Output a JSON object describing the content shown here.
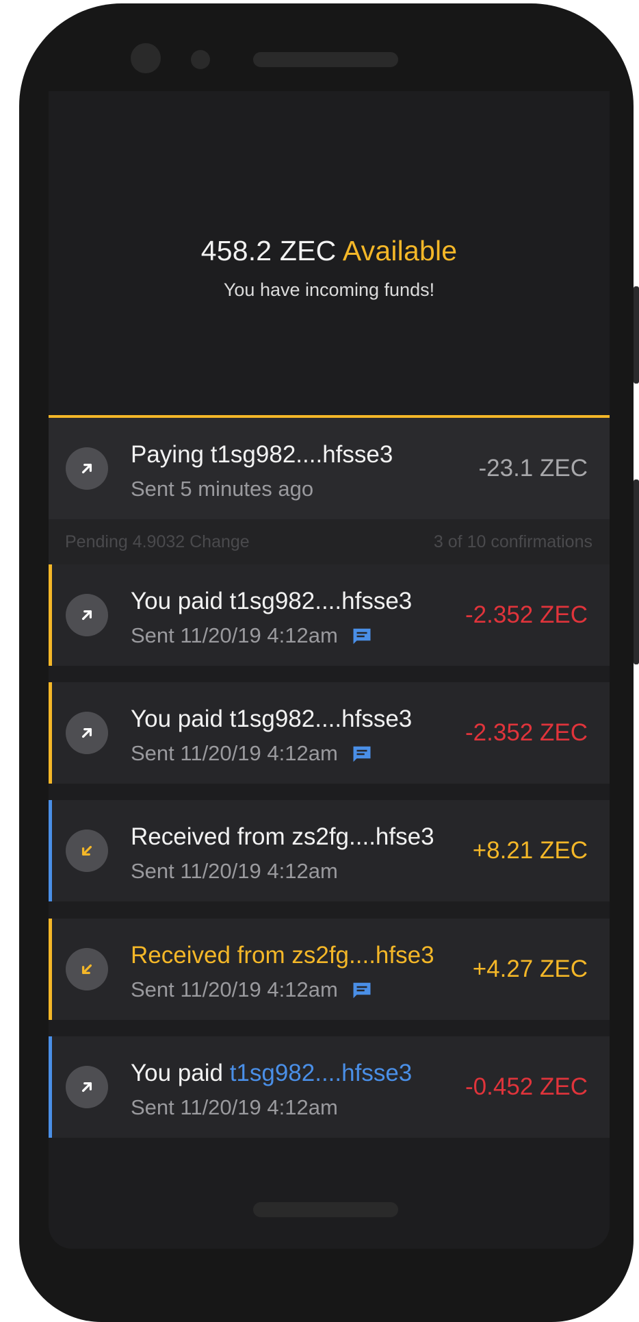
{
  "balance": {
    "amount": "458.2 ZEC",
    "status": "Available",
    "message": "You have incoming funds!"
  },
  "pending": {
    "title": "Paying t1sg982....hfsse3",
    "subtitle": "Sent 5 minutes ago",
    "amount": "-23.1 ZEC",
    "icon": "arrow-up-right-icon",
    "change": "Pending 4.9032 Change",
    "confirmations": "3 of 10 confirmations"
  },
  "transactions": [
    {
      "title": "You paid t1sg982....hfsse3",
      "subtitle": "Sent 11/20/19 4:12am",
      "amount": "-2.352 ZEC",
      "direction": "sent",
      "has_memo": true,
      "accent": "#f4b728",
      "amount_color": "#e0343b"
    },
    {
      "title": "You paid t1sg982....hfsse3",
      "subtitle": "Sent 11/20/19 4:12am",
      "amount": "-2.352 ZEC",
      "direction": "sent",
      "has_memo": true,
      "accent": "#f4b728",
      "amount_color": "#e0343b"
    },
    {
      "title": "Received from zs2fg....hfse3",
      "subtitle": "Sent 11/20/19 4:12am",
      "amount": "+8.21 ZEC",
      "direction": "received",
      "has_memo": false,
      "accent": "#4a8fe7",
      "amount_color": "#f4b728"
    },
    {
      "title": "Received from zs2fg....hfse3",
      "subtitle": "Sent 11/20/19 4:12am",
      "amount": "+4.27 ZEC",
      "direction": "received",
      "has_memo": true,
      "accent": "#f4b728",
      "amount_color": "#f4b728"
    },
    {
      "title_prefix": "You paid ",
      "title_address": "t1sg982....hfsse3",
      "subtitle": "Sent 11/20/19 4:12am",
      "amount": "-0.452 ZEC",
      "direction": "sent",
      "has_memo": false,
      "accent": "#4a8fe7",
      "amount_color": "#e0343b"
    }
  ],
  "colors": {
    "gold": "#f4b728",
    "blue": "#4a8fe7",
    "red": "#e0343b",
    "background": "#1d1d1f"
  }
}
